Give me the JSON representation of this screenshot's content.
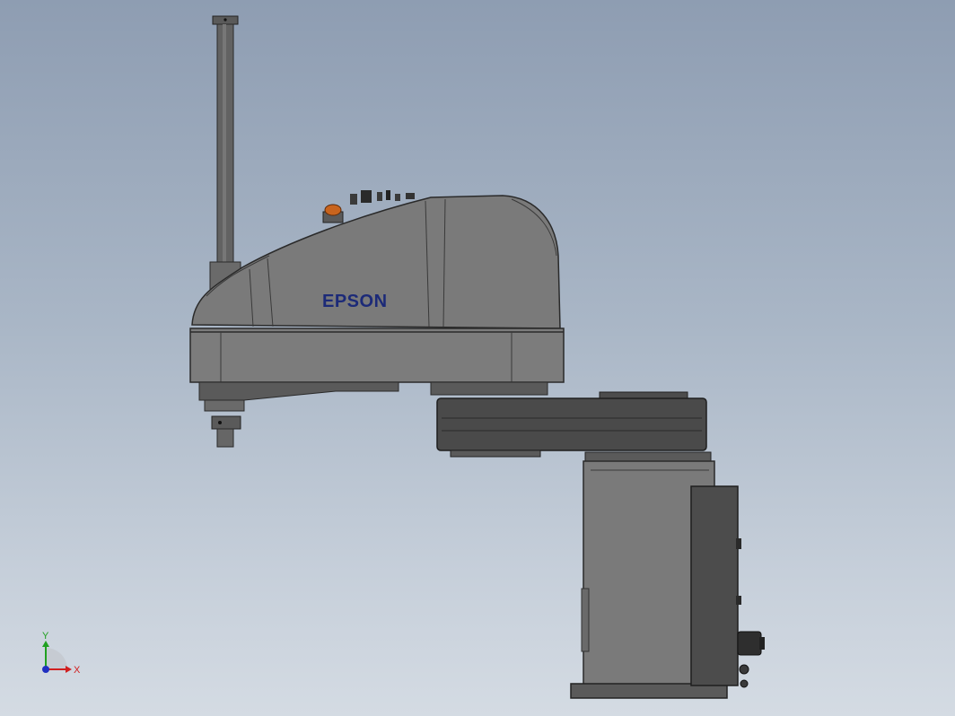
{
  "viewport": {
    "background_top": "#8e9db2",
    "background_bottom": "#d4dbe3"
  },
  "model": {
    "brand_label": "EPSON",
    "brand_color": "#1c2a78",
    "body_color": "#7a7a7a",
    "dark_color": "#4a4a4a",
    "lamp_color": "#c8641e"
  },
  "triad": {
    "x_label": "X",
    "y_label": "Y",
    "x_color": "#d02020",
    "y_color": "#20a020",
    "z_color": "#2030c0"
  }
}
